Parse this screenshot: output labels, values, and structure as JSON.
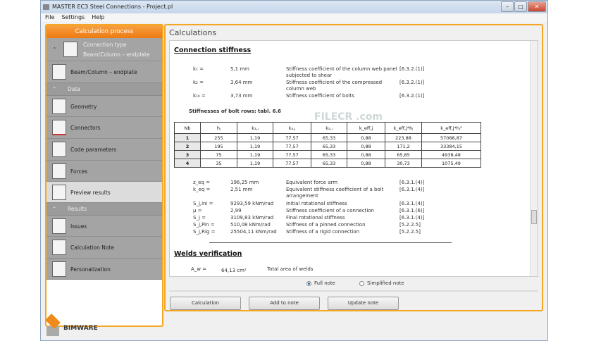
{
  "window": {
    "title": "MASTER EC3 Steel Connections - Project.pl",
    "minimize": "–",
    "maximize": "□",
    "close": "✕"
  },
  "menu": [
    "File",
    "Settings",
    "Help"
  ],
  "sidebar": {
    "header": "Calculation process",
    "connection_type_label": "Connection type",
    "connection_type_value": "Beam/Column – endplate",
    "connection_item": "Beam/Column – endplate",
    "sections": {
      "data": "Data",
      "results": "Results"
    },
    "items": {
      "geometry": "Geometry",
      "connectors": "Connectors",
      "code_parameters": "Code parameters",
      "forces": "Forces",
      "preview_results": "Preview results",
      "issues": "Issues",
      "calculation_note": "Calculation Note",
      "personalization": "Personalization"
    }
  },
  "main": {
    "title": "Calculations",
    "section1": "Connection stiffness",
    "coefs": [
      {
        "sym": "k₁ =",
        "val": "5,1 mm",
        "desc": "Stiffness coefficient of the column web panel subjected to shear",
        "ref": "[6.3.2.(1)]"
      },
      {
        "sym": "k₂ =",
        "val": "3,64 mm",
        "desc": "Stiffness coefficient of the compressed column web",
        "ref": "[6.3.2.(1)]"
      },
      {
        "sym": "k₁₀ =",
        "val": "3,73 mm",
        "desc": "Stiffness coefficient of bolts",
        "ref": "[6.3.2.(1)]"
      }
    ],
    "bolt_rows_label": "Stiffnesses of bolt rows:",
    "bolt_rows_ref": "tabl. 6.6",
    "table": {
      "headers": [
        "Nb",
        "hⱼ",
        "k₃,ⱼ",
        "k₄,ⱼ",
        "k₅,ⱼ",
        "k_eff,j",
        "k_eff,j*hⱼ",
        "k_eff,j*hⱼ²"
      ],
      "rows": [
        [
          "1",
          "255",
          "1,19",
          "77,57",
          "65,33",
          "0,88",
          "223,88",
          "57088,87"
        ],
        [
          "2",
          "195",
          "1,19",
          "77,57",
          "65,33",
          "0,88",
          "171,2",
          "33384,15"
        ],
        [
          "3",
          "75",
          "1,19",
          "77,57",
          "65,33",
          "0,88",
          "65,85",
          "4938,48"
        ],
        [
          "4",
          "35",
          "1,19",
          "77,57",
          "65,33",
          "0,88",
          "30,73",
          "1075,49"
        ]
      ]
    },
    "results": [
      {
        "sym": "z_eq =",
        "val": "196,25 mm",
        "desc": "Equivalent force arm",
        "ref": "[6.3.1.(4)]"
      },
      {
        "sym": "k_eq =",
        "val": "2,51 mm",
        "desc": "Equivalent stiffness coefficient of a bolt arrangement",
        "ref": "[6.3.1.(4)]"
      },
      {
        "sym": "S_j,ini =",
        "val": "9293,59 kNm/rad",
        "desc": "Initial rotational stiffness",
        "ref": "[6.3.1.(4)]"
      },
      {
        "sym": "μ =",
        "val": "2,99",
        "desc": "Stiffness coefficient of a connection",
        "ref": "[6.3.1.(6)]"
      },
      {
        "sym": "S_j =",
        "val": "3109,83 kNm/rad",
        "desc": "Final rotational stiffness",
        "ref": "[6.3.1.(4)]"
      },
      {
        "sym": "S_j,Pin =",
        "val": "510,08 kNm/rad",
        "desc": "Stiffness of a pinned connection",
        "ref": "[5.2.2.5]"
      },
      {
        "sym": "S_j,Rig =",
        "val": "25504,11 kNm/rad",
        "desc": "Stiffness of a rigid connection",
        "ref": "[5.2.2.5]"
      }
    ],
    "section2": "Welds verification",
    "welds": {
      "sym": "A_w =",
      "val": "64,13 cm²",
      "desc": "Total area of welds"
    },
    "radio_full": "Full note",
    "radio_simplified": "Simplified note",
    "buttons": {
      "calculation": "Calculation",
      "add": "Add to note",
      "update": "Update note"
    },
    "watermark": "FILECR .com"
  },
  "logo": "BIMWARE"
}
